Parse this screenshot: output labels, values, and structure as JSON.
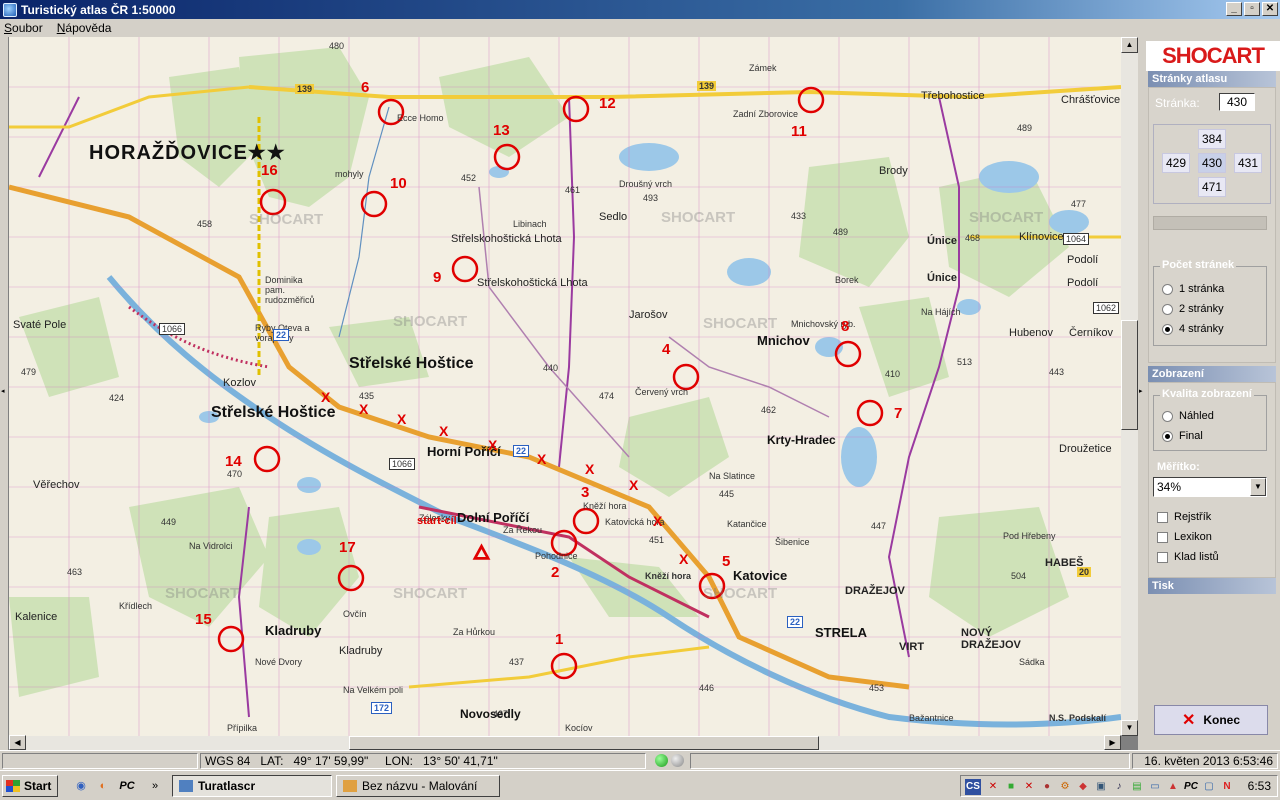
{
  "window": {
    "title": "Turistický atlas ČR 1:50000",
    "buttons": {
      "minimize": "_",
      "restore": "▫",
      "close": "✕"
    }
  },
  "menu": [
    "Soubor",
    "Nápověda"
  ],
  "map": {
    "towns": {
      "horazdovice": "HORAŽĎOVICE★★",
      "strelske_hostice_1": "Střelské Hoštice",
      "strelske_hostice_2": "Střelské Hoštice",
      "horni_porici": "Horní Poříčí",
      "dolni_porici": "Dolní Poříčí",
      "katovice": "Katovice",
      "strela": "STRELA",
      "krty_hradec": "Krty-Hradec",
      "mnichov": "Mnichov",
      "kladruby_1": "Kladruby",
      "kladruby_2": "Kladruby",
      "novosedly": "Novosedly",
      "drazejov": "DRAŽEJOV",
      "novy_drazejov": "NOVÝ DRAŽEJOV",
      "virt": "VIRT",
      "habes": "HABEŠ",
      "unice_1": "Únice",
      "unice_2": "Únice",
      "brody": "Brody",
      "podoli_1": "Podolí",
      "podoli_2": "Podolí",
      "klinovice": "Klínovice",
      "cernikov": "Černíkov",
      "hubenov": "Hubenov",
      "drouzetice": "Droužetice",
      "trebohostice": "Třebohostice",
      "chrastovice": "Chrášťovice",
      "zamek": "Zámek",
      "zadni_zborovice": "Zadní Zborovice",
      "sedlo": "Sedlo",
      "strelskohosticka_lhota_1": "Střelskohoštická Lhota",
      "strelskohosticka_lhota_2": "Střelskohoštická Lhota",
      "jarosov": "Jarošov",
      "libinach": "Libinach",
      "svate_pole": "Svaté Pole",
      "kozlov": "Kozlov",
      "verechov": "Věřechov",
      "kalenice": "Kalenice",
      "krizlech": "Křídlech",
      "zalesky": "Zálesky",
      "za_rekou": "Za Řekou",
      "pohodnice": "Pohodnice",
      "na_vidrolci": "Na Vidrolci",
      "ovcin": "Ovčín",
      "za_hurkou": "Za Hůrkou",
      "na_velkem_poli": "Na Velkém poli",
      "na_hajich": "Na Hájích",
      "borek": "Borek",
      "na_slatince": "Na Slatince",
      "pod_hrebeny": "Pod Hřebeny",
      "kneizi_hora": "Kněží hora",
      "katovicka_hora": "Katovická hora",
      "nove_dvory": "Nové Dvory",
      "pripilka": "Přípilka",
      "kociov": "Kocíov",
      "droushy_vrch": "Droušný vrch",
      "sibenice": "Šibenice",
      "cervene_vrch": "Červený vrch",
      "mnichovsky_ryb": "Mnichovský ryb.",
      "kaitan": "Katančice",
      "bazantnice": "Bažantnice",
      "sadka": "Sádka",
      "nasi": "N.S. Podskalí",
      "kneizi_hora_2": "Kněží hora",
      "ecce_homo": "Ecce Homo",
      "molyly": "mohyly",
      "dominika": "Dominika pam. rudozměřiců",
      "rodina": "Ryby Oteva a vorapluvy"
    },
    "watermark": [
      "SHOCART",
      "SHOCART",
      "SHOCART",
      "SHOCART",
      "SHOCART",
      "SHOCART",
      "SHOCART",
      "SHOCART"
    ],
    "markers": [
      "1",
      "2",
      "3",
      "4",
      "5",
      "6",
      "7",
      "8",
      "9",
      "10",
      "11",
      "12",
      "13",
      "14",
      "15",
      "16",
      "17"
    ],
    "start_label": "start-cíl",
    "route_marks": [
      "X",
      "X",
      "X",
      "X",
      "X",
      "X",
      "X",
      "X",
      "X",
      "X"
    ],
    "road_numbers": [
      "139",
      "139",
      "22",
      "22",
      "1066",
      "1066",
      "1064",
      "1062",
      "172",
      "22",
      "20"
    ],
    "spot_heights": [
      "480",
      "452",
      "461",
      "493",
      "433",
      "435",
      "447",
      "445",
      "440",
      "437",
      "463",
      "489",
      "477",
      "468",
      "513",
      "458",
      "470",
      "437",
      "462",
      "443",
      "449",
      "479",
      "451",
      "474",
      "489",
      "504",
      "424",
      "410",
      "453",
      "446"
    ]
  },
  "side": {
    "logo": "SHOCART",
    "pages_head": "Stránky atlasu",
    "page_label": "Stránka:",
    "page_value": "430",
    "grid": {
      "top": "384",
      "left": "429",
      "center": "430",
      "right": "431",
      "bottom": "471"
    },
    "count_title": "Počet stránek",
    "count_options": [
      "1 stránka",
      "2 stránky",
      "4 stránky"
    ],
    "display_head": "Zobrazení",
    "quality_title": "Kvalita zobrazení",
    "quality_options": [
      "Náhled",
      "Final"
    ],
    "scale_label": "Měřítko:",
    "scale_value": "34%",
    "checks": [
      "Rejstřík",
      "Lexikon",
      "Klad listů"
    ],
    "print_head": "Tisk",
    "exit_label": "Konec"
  },
  "status": {
    "datum": "WGS 84",
    "lat_label": "LAT:",
    "lat_value": "49°   17'  59,99\"",
    "lon_label": "LON:",
    "lon_value": "13°   50'  41,71\"",
    "datetime": "16. květen 2013 6:53:46"
  },
  "taskbar": {
    "start": "Start",
    "items": [
      "Turatlascr",
      "Bez názvu - Malování"
    ],
    "clock": "6:53",
    "chevron": "»",
    "tray_lang": "CS"
  },
  "colors": {
    "marker": "#e00000",
    "road_yellow": "#f2cc3a",
    "road_orange": "#e8a030",
    "water": "#9cc8e8",
    "forest": "#cfe2b8",
    "grid": "#d070c0"
  }
}
